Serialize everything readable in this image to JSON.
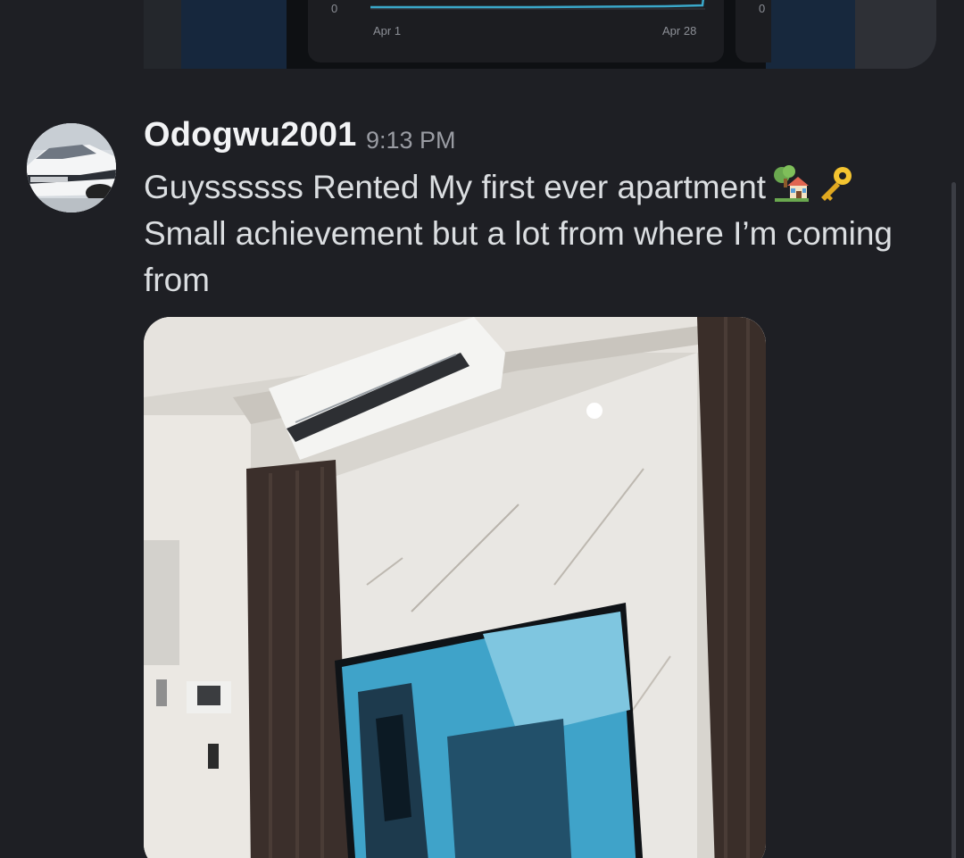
{
  "previous_attachment": {
    "chart_left": {
      "y_tick": "0",
      "x_ticks": [
        "Apr 1",
        "Apr 28"
      ]
    },
    "chart_right": {
      "y_tick": "0"
    }
  },
  "message": {
    "username": "Odogwu2001",
    "timestamp": "9:13 PM",
    "lines": [
      "Guyssssss Rented My first ever apartment",
      "Small achievement but a lot from where I’m coming",
      "from"
    ],
    "emojis": [
      "house-with-garden-icon",
      "key-icon"
    ]
  },
  "colors": {
    "background": "#1e1f24",
    "username": "#f2f3f5",
    "timestamp": "#9a9ca3",
    "message_text": "#dbdee1",
    "chart_line": "#3aa7c9"
  }
}
